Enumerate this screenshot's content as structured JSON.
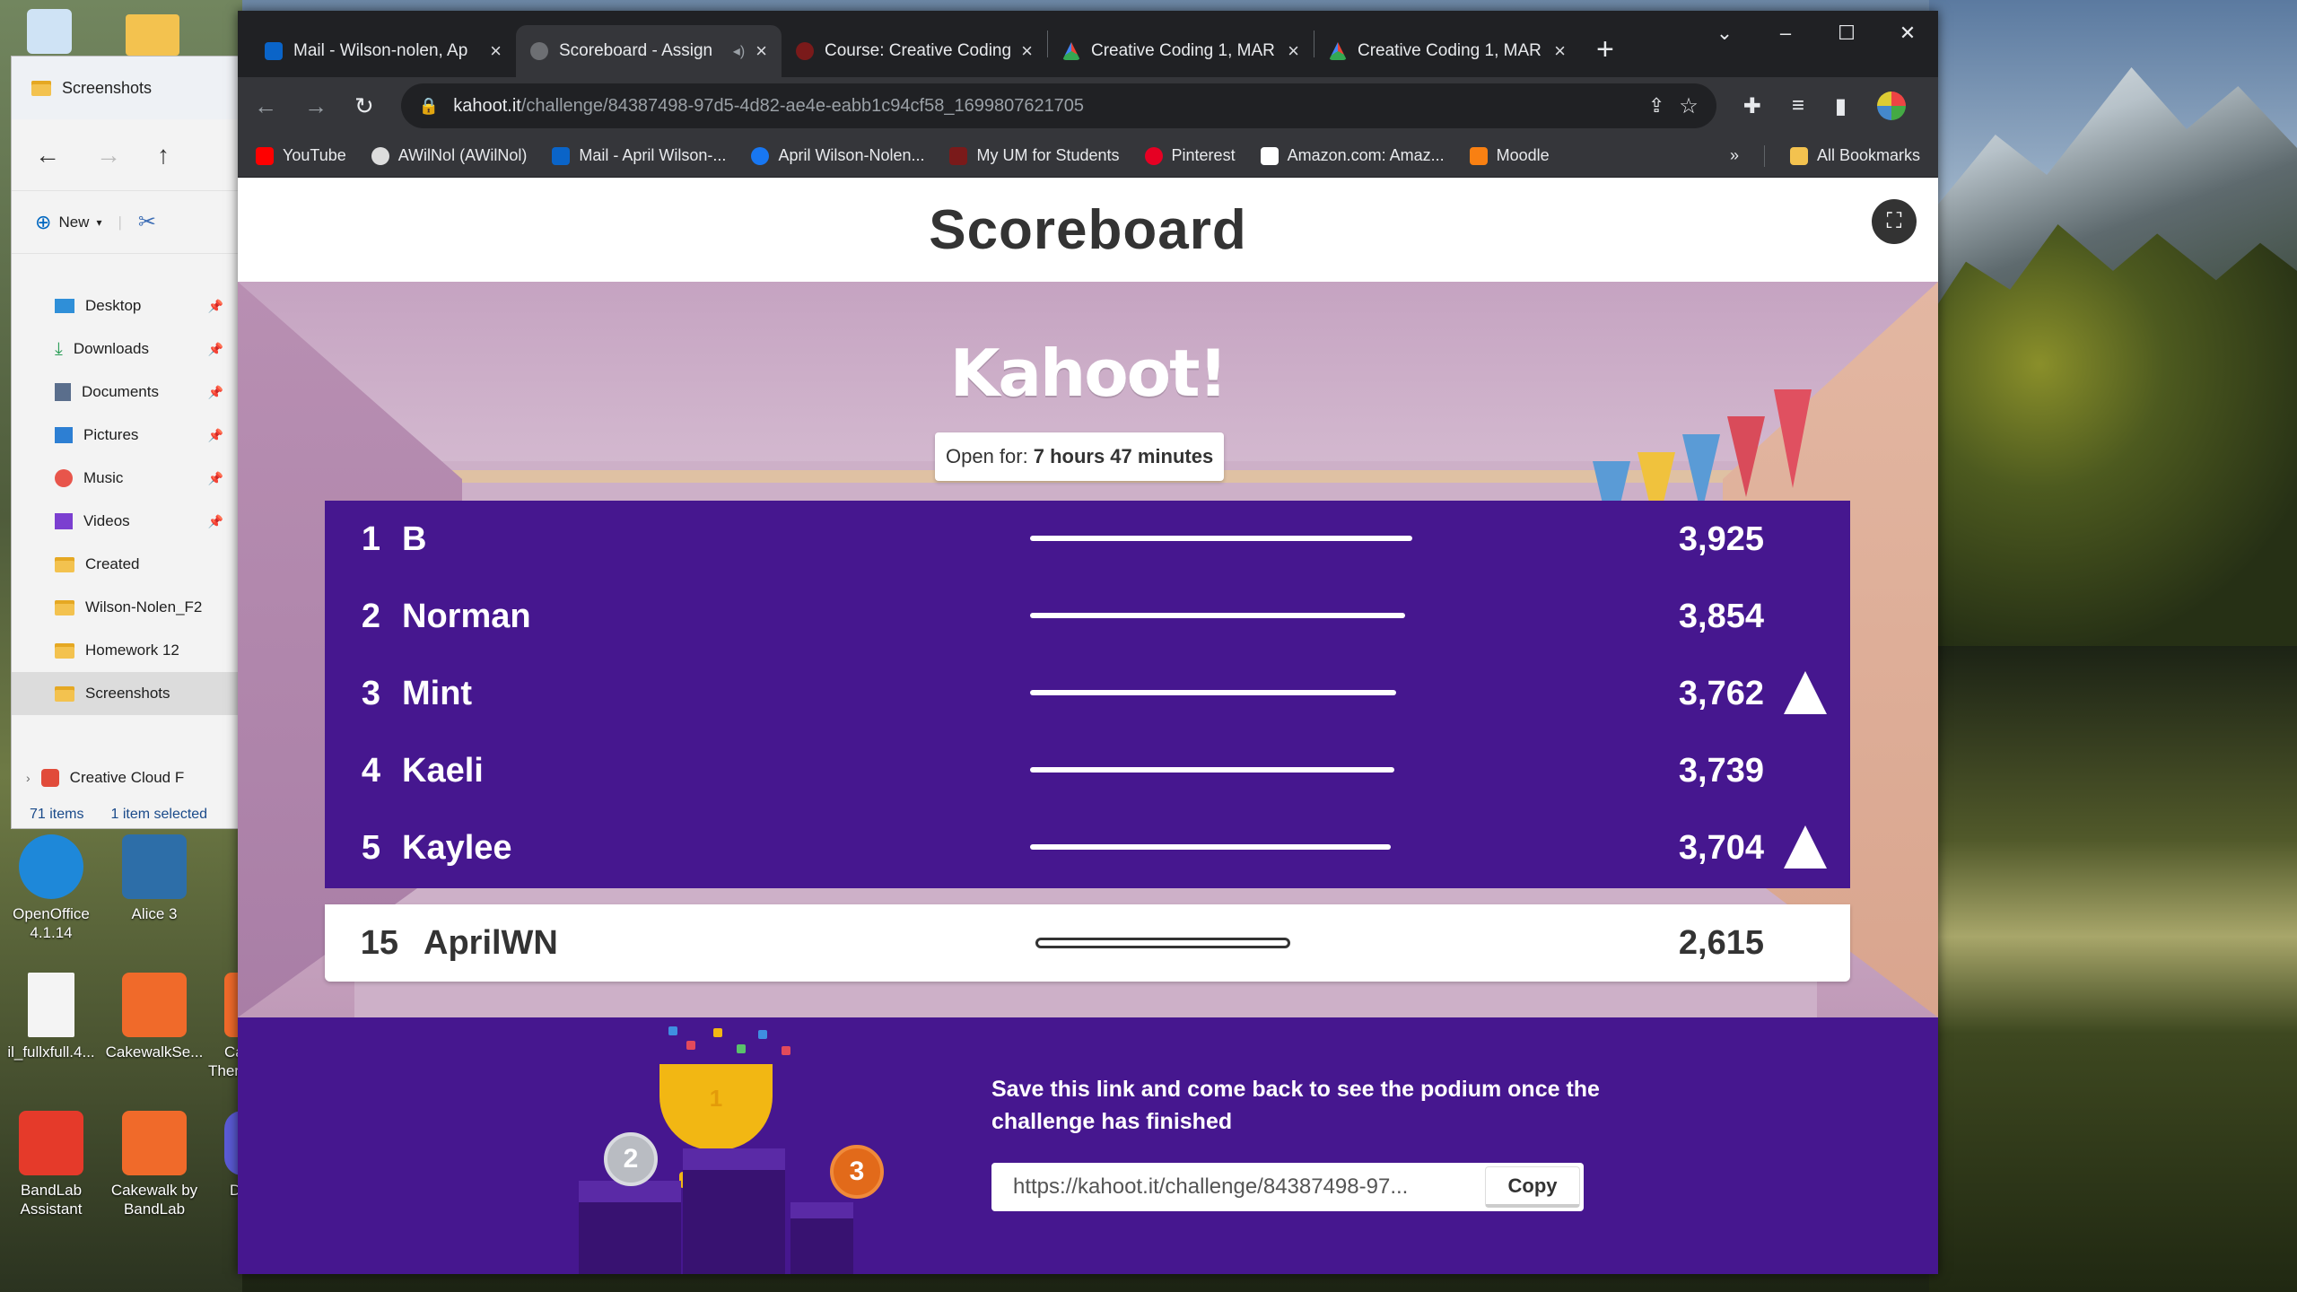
{
  "desktop": {
    "icons": [
      {
        "label": "OpenOffice 4.1.14",
        "color": "#1e88d9"
      },
      {
        "label": "Alice 3",
        "color": "#2d6ea8"
      },
      {
        "label": "il_fullxfull.4...",
        "color": "#f4f4f4"
      },
      {
        "label": "CakewalkSe...",
        "color": "#f06a2a"
      },
      {
        "label": "BandLab Assistant",
        "color": "#e53a2a"
      },
      {
        "label": "Cakewalk by BandLab",
        "color": "#f06a2a"
      }
    ],
    "partial_labels": [
      "Ca",
      "Ther",
      "D"
    ]
  },
  "explorer": {
    "title": "Screenshots",
    "new_label": "New",
    "items": [
      {
        "label": "Desktop",
        "icon": "desktop-icon",
        "pinned": true
      },
      {
        "label": "Downloads",
        "icon": "download-icon",
        "pinned": true
      },
      {
        "label": "Documents",
        "icon": "document-icon",
        "pinned": true
      },
      {
        "label": "Pictures",
        "icon": "picture-icon",
        "pinned": true
      },
      {
        "label": "Music",
        "icon": "music-icon",
        "pinned": true
      },
      {
        "label": "Videos",
        "icon": "video-icon",
        "pinned": true
      },
      {
        "label": "Created",
        "icon": "folder-icon",
        "pinned": false
      },
      {
        "label": "Wilson-Nolen_F2",
        "icon": "folder-icon",
        "pinned": false
      },
      {
        "label": "Homework 12",
        "icon": "folder-icon",
        "pinned": false
      },
      {
        "label": "Screenshots",
        "icon": "folder-icon",
        "pinned": false,
        "selected": true
      }
    ],
    "cloud_item": "Creative Cloud F",
    "status_count": "71 items",
    "status_selected": "1 item selected"
  },
  "browser": {
    "tabs": [
      {
        "title": "Mail - Wilson-nolen, Ap",
        "favicon_color": "#0a64c8",
        "active": false
      },
      {
        "title": "Scoreboard - Assign",
        "favicon_color": "#6d6f73",
        "active": true
      },
      {
        "title": "Course: Creative Coding",
        "favicon_color": "#7a1a1a",
        "active": false
      },
      {
        "title": "Creative Coding 1, MAR",
        "favicon_color": "#4285f4",
        "active": false
      },
      {
        "title": "Creative Coding 1, MAR",
        "favicon_color": "#34a853",
        "active": false
      }
    ],
    "url_host": "kahoot.it",
    "url_path": "/challenge/84387498-97d5-4d82-ae4e-eabb1c94cf58_1699807621705",
    "bookmarks": [
      {
        "label": "YouTube",
        "color": "#ff0000"
      },
      {
        "label": "AWilNol (AWilNol)",
        "color": "#dddddd"
      },
      {
        "label": "Mail - April Wilson-...",
        "color": "#0a64c8"
      },
      {
        "label": "April Wilson-Nolen...",
        "color": "#1877f2"
      },
      {
        "label": "My UM for Students",
        "color": "#7a1a1a"
      },
      {
        "label": "Pinterest",
        "color": "#e60023"
      },
      {
        "label": "Amazon.com: Amaz...",
        "color": "#ffffff"
      },
      {
        "label": "Moodle",
        "color": "#f98012"
      }
    ],
    "all_bookmarks": "All Bookmarks",
    "more_bookmarks": "»"
  },
  "page": {
    "title": "Scoreboard",
    "logo": "Kahoot!",
    "open_label": "Open for:",
    "open_value": "7 hours 47 minutes",
    "leaderboard": [
      {
        "rank": "1",
        "name": "B",
        "score": "3,925",
        "score_value": 3925,
        "trend_up": false
      },
      {
        "rank": "2",
        "name": "Norman",
        "score": "3,854",
        "score_value": 3854,
        "trend_up": false
      },
      {
        "rank": "3",
        "name": "Mint",
        "score": "3,762",
        "score_value": 3762,
        "trend_up": true
      },
      {
        "rank": "4",
        "name": "Kaeli",
        "score": "3,739",
        "score_value": 3739,
        "trend_up": false
      },
      {
        "rank": "5",
        "name": "Kaylee",
        "score": "3,704",
        "score_value": 3704,
        "trend_up": true
      }
    ],
    "my_row": {
      "rank": "15",
      "name": "AprilWN",
      "score": "2,615",
      "score_value": 2615
    },
    "save_text": "Save this link and come back to see the podium once the challenge has finished",
    "link_value": "https://kahoot.it/challenge/84387498-97...",
    "copy_label": "Copy",
    "podium": {
      "second": "2",
      "first": "1",
      "third": "3"
    }
  },
  "colors": {
    "kahoot_purple": "#46178f",
    "chrome_dark": "#202124",
    "chrome_mid": "#35363a"
  }
}
